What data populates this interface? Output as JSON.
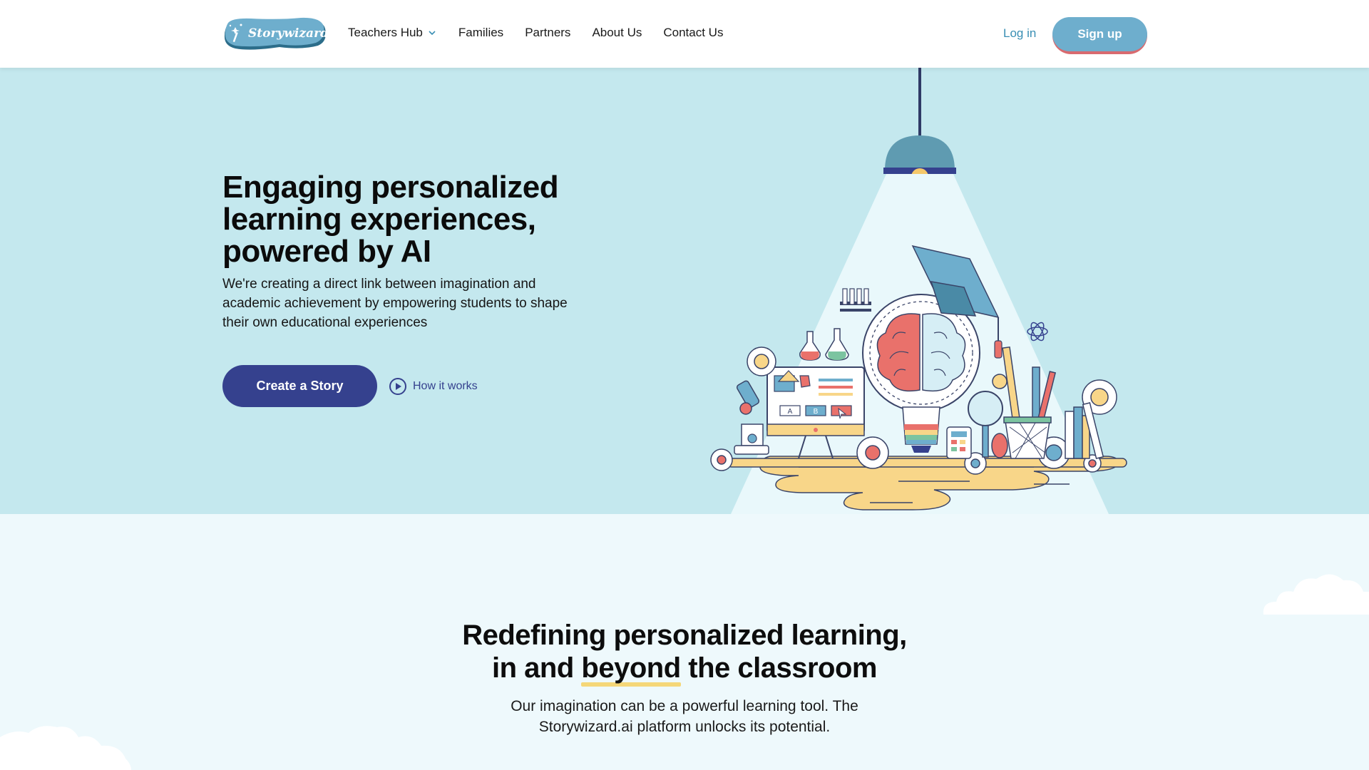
{
  "nav": {
    "logo_text": "Storywizard.ai",
    "items": [
      {
        "label": "Teachers Hub",
        "has_dropdown": true
      },
      {
        "label": "Families"
      },
      {
        "label": "Partners"
      },
      {
        "label": "About Us"
      },
      {
        "label": "Contact Us"
      }
    ],
    "login_label": "Log in",
    "signup_label": "Sign up"
  },
  "hero": {
    "title": "Engaging personalized learning experiences, powered by AI",
    "subtitle": "We're creating a direct link between imagination and academic achievement by empowering students to shape their own educational experiences",
    "cta_label": "Create a Story",
    "how_label": "How it works"
  },
  "illustration": {
    "board_labels": [
      "A",
      "B"
    ]
  },
  "section": {
    "title_line1": "Redefining personalized learning,",
    "title_pre": "in and ",
    "title_highlight": "beyond",
    "title_post": " the classroom",
    "subtitle": "Our imagination can be a powerful learning tool. The Storywizard.ai platform unlocks its potential."
  },
  "colors": {
    "nav_bg": "#ffffff",
    "hero_bg": "#c4e8ee",
    "section_bg": "#eef9fc",
    "primary": "#35418e",
    "accent_blue": "#6eaecd",
    "accent_red": "#d86a6f",
    "link": "#3a8fb4",
    "highlight": "#f5d778"
  }
}
